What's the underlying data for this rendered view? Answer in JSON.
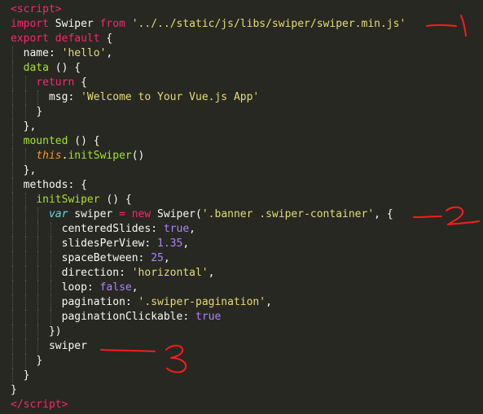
{
  "editor": {
    "theme": "dark",
    "lines": [
      {
        "indent": 0,
        "tokens": [
          [
            "tag",
            "<"
          ],
          [
            "tag",
            "script"
          ],
          [
            "tag",
            ">"
          ]
        ]
      },
      {
        "indent": 0,
        "tokens": [
          [
            "kw",
            "import"
          ],
          [
            "plain",
            " Swiper "
          ],
          [
            "kw",
            "from"
          ],
          [
            "plain",
            " "
          ],
          [
            "str",
            "'../../static/js/libs/swiper/swiper.min.js'"
          ]
        ]
      },
      {
        "indent": 0,
        "tokens": [
          [
            "kw",
            "export"
          ],
          [
            "plain",
            " "
          ],
          [
            "kw",
            "default"
          ],
          [
            "plain",
            " {"
          ]
        ]
      },
      {
        "indent": 1,
        "tokens": [
          [
            "plain",
            "name: "
          ],
          [
            "str",
            "'hello'"
          ],
          [
            "plain",
            ","
          ]
        ]
      },
      {
        "indent": 1,
        "tokens": [
          [
            "fn",
            "data"
          ],
          [
            "plain",
            " () {"
          ]
        ]
      },
      {
        "indent": 2,
        "tokens": [
          [
            "kw",
            "return"
          ],
          [
            "plain",
            " {"
          ]
        ]
      },
      {
        "indent": 3,
        "tokens": [
          [
            "plain",
            "msg: "
          ],
          [
            "str",
            "'Welcome to Your Vue.js App'"
          ]
        ]
      },
      {
        "indent": 2,
        "tokens": [
          [
            "plain",
            "}"
          ]
        ]
      },
      {
        "indent": 1,
        "tokens": [
          [
            "plain",
            "},"
          ]
        ]
      },
      {
        "indent": 1,
        "tokens": [
          [
            "fn",
            "mounted"
          ],
          [
            "plain",
            " () {"
          ]
        ]
      },
      {
        "indent": 2,
        "tokens": [
          [
            "this",
            "this"
          ],
          [
            "plain",
            "."
          ],
          [
            "fn",
            "initSwiper"
          ],
          [
            "plain",
            "()"
          ]
        ]
      },
      {
        "indent": 1,
        "tokens": [
          [
            "plain",
            "},"
          ]
        ]
      },
      {
        "indent": 1,
        "tokens": [
          [
            "plain",
            "methods: {"
          ]
        ]
      },
      {
        "indent": 2,
        "tokens": [
          [
            "fn",
            "initSwiper"
          ],
          [
            "plain",
            " () {"
          ]
        ]
      },
      {
        "indent": 3,
        "tokens": [
          [
            "storage",
            "var"
          ],
          [
            "plain",
            " swiper "
          ],
          [
            "kw",
            "="
          ],
          [
            "plain",
            " "
          ],
          [
            "kw",
            "new"
          ],
          [
            "plain",
            " Swiper("
          ],
          [
            "str",
            "'.banner .swiper-container'"
          ],
          [
            "plain",
            ", {"
          ]
        ]
      },
      {
        "indent": 4,
        "tokens": [
          [
            "plain",
            "centeredSlides: "
          ],
          [
            "num",
            "true"
          ],
          [
            "plain",
            ","
          ]
        ]
      },
      {
        "indent": 4,
        "tokens": [
          [
            "plain",
            "slidesPerView: "
          ],
          [
            "num",
            "1.35"
          ],
          [
            "plain",
            ","
          ]
        ]
      },
      {
        "indent": 4,
        "tokens": [
          [
            "plain",
            "spaceBetween: "
          ],
          [
            "num",
            "25"
          ],
          [
            "plain",
            ","
          ]
        ]
      },
      {
        "indent": 4,
        "tokens": [
          [
            "plain",
            "direction: "
          ],
          [
            "str",
            "'horizontal'"
          ],
          [
            "plain",
            ","
          ]
        ]
      },
      {
        "indent": 4,
        "tokens": [
          [
            "plain",
            "loop: "
          ],
          [
            "num",
            "false"
          ],
          [
            "plain",
            ","
          ]
        ]
      },
      {
        "indent": 4,
        "tokens": [
          [
            "plain",
            "pagination: "
          ],
          [
            "str",
            "'.swiper-pagination'"
          ],
          [
            "plain",
            ","
          ]
        ]
      },
      {
        "indent": 4,
        "tokens": [
          [
            "plain",
            "paginationClickable: "
          ],
          [
            "num",
            "true"
          ]
        ]
      },
      {
        "indent": 3,
        "tokens": [
          [
            "plain",
            "})"
          ]
        ]
      },
      {
        "indent": 3,
        "tokens": [
          [
            "plain",
            "swiper"
          ]
        ]
      },
      {
        "indent": 2,
        "tokens": [
          [
            "plain",
            "}"
          ]
        ]
      },
      {
        "indent": 1,
        "tokens": [
          [
            "plain",
            "}"
          ]
        ]
      },
      {
        "indent": 0,
        "tokens": [
          [
            "plain",
            "}"
          ]
        ]
      },
      {
        "indent": 0,
        "tokens": [
          [
            "tag",
            "</"
          ],
          [
            "tag",
            "script"
          ],
          [
            "tag",
            ">"
          ]
        ]
      }
    ]
  },
  "annotations": [
    {
      "label": "1",
      "color": "#ff1a1a"
    },
    {
      "label": "2",
      "color": "#ff1a1a"
    },
    {
      "label": "3",
      "color": "#ff1a1a"
    }
  ]
}
